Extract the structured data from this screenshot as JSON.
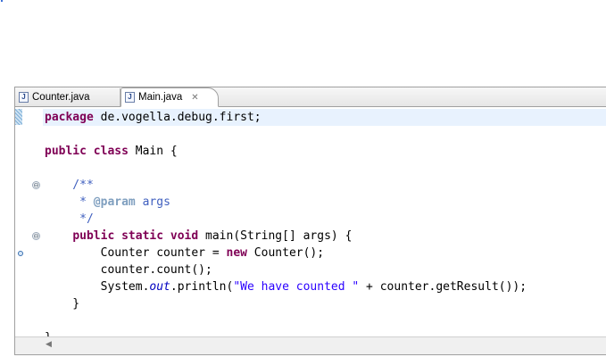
{
  "tabs": [
    {
      "label": "Counter.java",
      "active": false
    },
    {
      "label": "Main.java",
      "active": true
    }
  ],
  "icons": {
    "java_file": "J",
    "close": "✕",
    "fold": "⊖",
    "scroll_left": "◀"
  },
  "code": {
    "l1_kw": "package",
    "l1_rest": " de.vogella.debug.first;",
    "l3_kw": "public class",
    "l3_rest": " Main {",
    "l5": "    /**",
    "l6_pre": "     * ",
    "l6_tag": "@param",
    "l6_rest": " args",
    "l7": "     */",
    "l8_indent": "    ",
    "l8_kw": "public static void",
    "l8_rest": " main(String[] args) {",
    "l9_pre": "        Counter counter = ",
    "l9_kw": "new",
    "l9_rest": " Counter();",
    "l10": "        counter.count();",
    "l11_pre": "        System.",
    "l11_field": "out",
    "l11_mid": ".println(",
    "l11_str": "\"We have counted \"",
    "l11_rest": " + counter.getResult());",
    "l12": "    }",
    "l14": "}"
  }
}
